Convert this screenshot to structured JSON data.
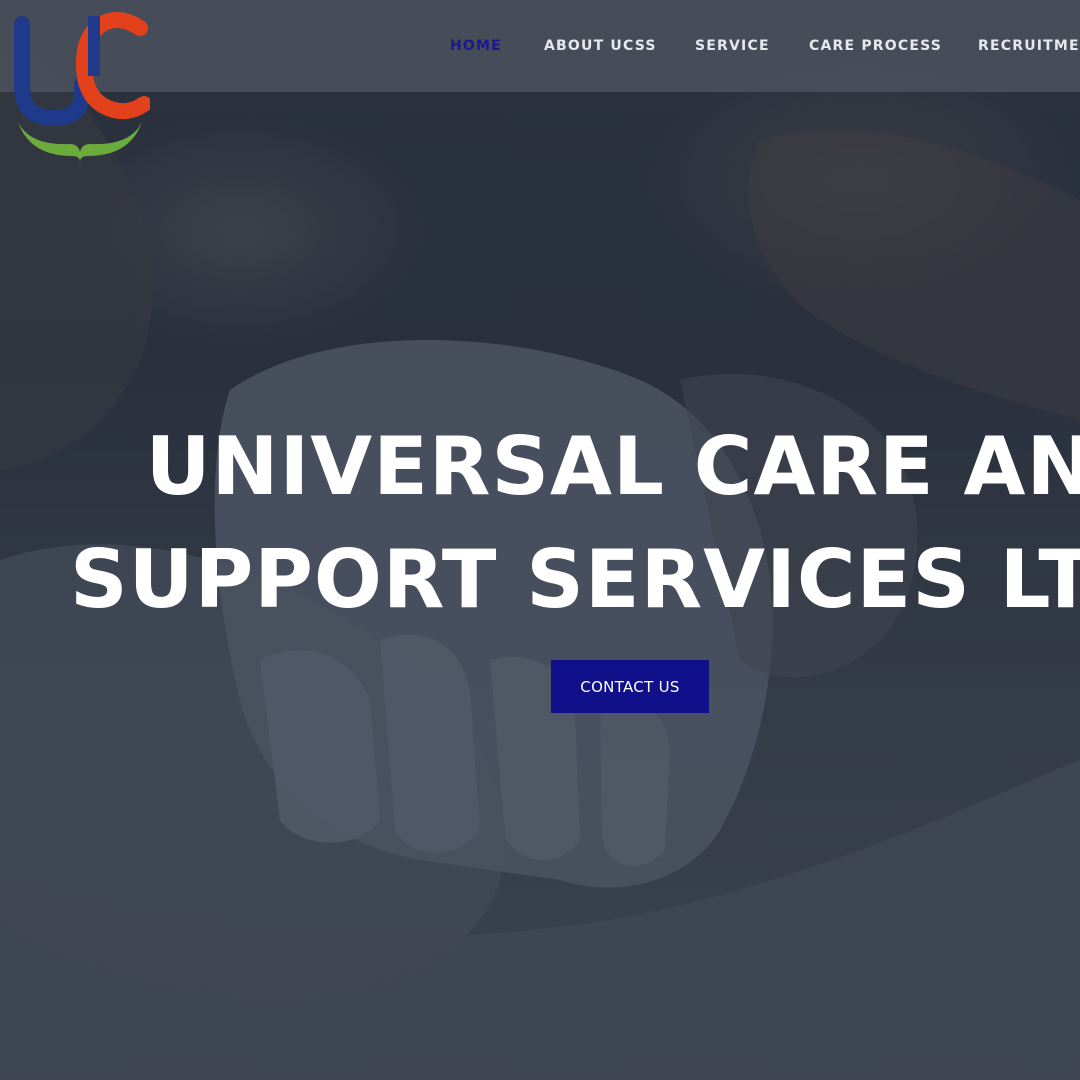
{
  "nav": {
    "items": [
      {
        "label": "HOME",
        "active": true
      },
      {
        "label": "ABOUT UCSS",
        "active": false
      },
      {
        "label": "SERVICE",
        "active": false
      },
      {
        "label": "CARE PROCESS",
        "active": false
      },
      {
        "label": "RECRUITMEN",
        "active": false
      }
    ]
  },
  "hero": {
    "title_line1": "UNIVERSAL CARE AN",
    "title_line2": "SUPPORT SERVICES LT",
    "cta_label": "CONTACT US",
    "background": "hands-holding-photo"
  },
  "logo": {
    "name": "ucss-logo",
    "colors": {
      "blue": "#1f3a8a",
      "red": "#e3411b",
      "green": "#6aab3c"
    }
  },
  "colors": {
    "accent": "#10108a",
    "nav_active": "#1a1a8c",
    "nav_text": "#e6e8ec",
    "title": "#ffffff"
  }
}
